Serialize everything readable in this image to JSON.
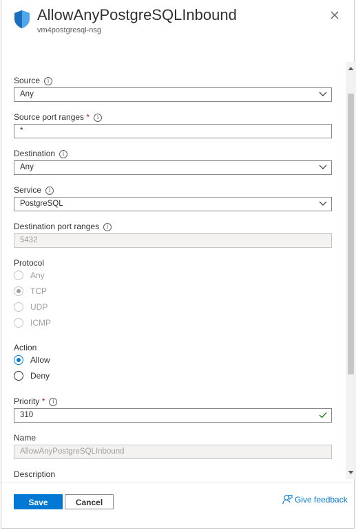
{
  "header": {
    "title": "AllowAnyPostgreSQLInbound",
    "subtitle": "vm4postgresql-nsg"
  },
  "form": {
    "source": {
      "label": "Source",
      "value": "Any"
    },
    "source_port_ranges": {
      "label": "Source port ranges",
      "required_mark": "*",
      "value": "*"
    },
    "destination": {
      "label": "Destination",
      "value": "Any"
    },
    "service": {
      "label": "Service",
      "value": "PostgreSQL"
    },
    "destination_port_ranges": {
      "label": "Destination port ranges",
      "value": "5432"
    },
    "protocol": {
      "label": "Protocol",
      "options": [
        "Any",
        "TCP",
        "UDP",
        "ICMP"
      ],
      "selected": "TCP"
    },
    "action": {
      "label": "Action",
      "options": [
        "Allow",
        "Deny"
      ],
      "selected": "Allow"
    },
    "priority": {
      "label": "Priority",
      "required_mark": "*",
      "value": "310"
    },
    "name": {
      "label": "Name",
      "value": "AllowAnyPostgreSQLInbound"
    },
    "description": {
      "label": "Description"
    },
    "info_glyph": "i"
  },
  "footer": {
    "save_label": "Save",
    "cancel_label": "Cancel",
    "feedback_label": "Give feedback"
  },
  "colors": {
    "accent": "#0078d4",
    "required": "#a4262c",
    "valid": "#107c10",
    "disabled_bg": "#f3f2f1"
  },
  "icons": {
    "shield": "shield-icon",
    "close": "close-icon",
    "chevron": "chevron-down-icon",
    "info": "info-icon",
    "check": "checkmark-icon",
    "feedback": "feedback-icon"
  }
}
